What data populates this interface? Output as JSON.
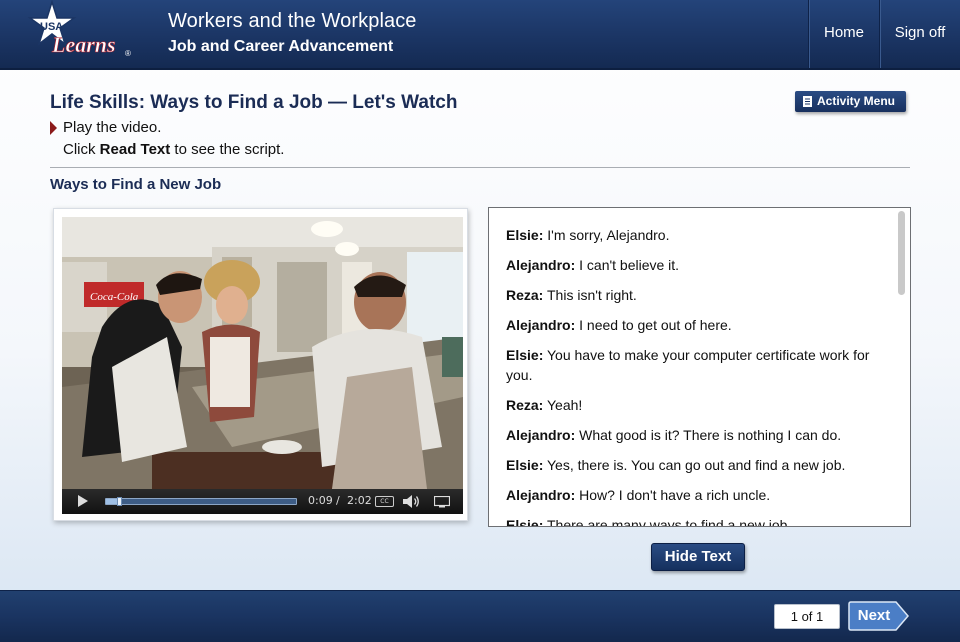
{
  "header": {
    "logo_text": "USA Learns",
    "title": "Workers and the Workplace",
    "subtitle": "Job and Career Advancement",
    "nav": [
      {
        "label": "Home"
      },
      {
        "label": "Sign off"
      }
    ]
  },
  "main": {
    "page_title": "Life Skills: Ways to Find a Job — Let's Watch",
    "activity_menu_label": "Activity Menu",
    "instructions": {
      "line1": "Play the video.",
      "line2_prefix": "Click ",
      "line2_bold": "Read Text",
      "line2_suffix": " to see the script."
    },
    "section_title": "Ways to Find a New Job"
  },
  "video": {
    "current_time": "0:09",
    "separator": "/",
    "duration": "2:02",
    "progress_fraction": 0.074,
    "cc_label": "CC"
  },
  "transcript": {
    "lines": [
      {
        "speaker": "Elsie:",
        "text": "I'm sorry, Alejandro."
      },
      {
        "speaker": "Alejandro:",
        "text": "I can't believe it."
      },
      {
        "speaker": "Reza:",
        "text": "This isn't right."
      },
      {
        "speaker": "Alejandro:",
        "text": "I need to get out of here."
      },
      {
        "speaker": "Elsie:",
        "text": "You have to make your computer certificate work for you."
      },
      {
        "speaker": "Reza:",
        "text": "Yeah!"
      },
      {
        "speaker": "Alejandro:",
        "text": "What good is it? There is nothing I can do."
      },
      {
        "speaker": "Elsie:",
        "text": "Yes, there is. You can go out and find a new job."
      },
      {
        "speaker": "Alejandro:",
        "text": "How? I don't have a rich uncle."
      },
      {
        "speaker": "Elsie:",
        "text": "There are many ways to find a new job."
      }
    ],
    "hide_text_label": "Hide Text"
  },
  "footer": {
    "page_counter": "1 of 1",
    "next_label": "Next"
  },
  "colors": {
    "header_navy": "#1b3564",
    "title_navy": "#1b2c55",
    "instruction_arrow": "#8b1a1a",
    "next_button": "#4b7ec6"
  }
}
